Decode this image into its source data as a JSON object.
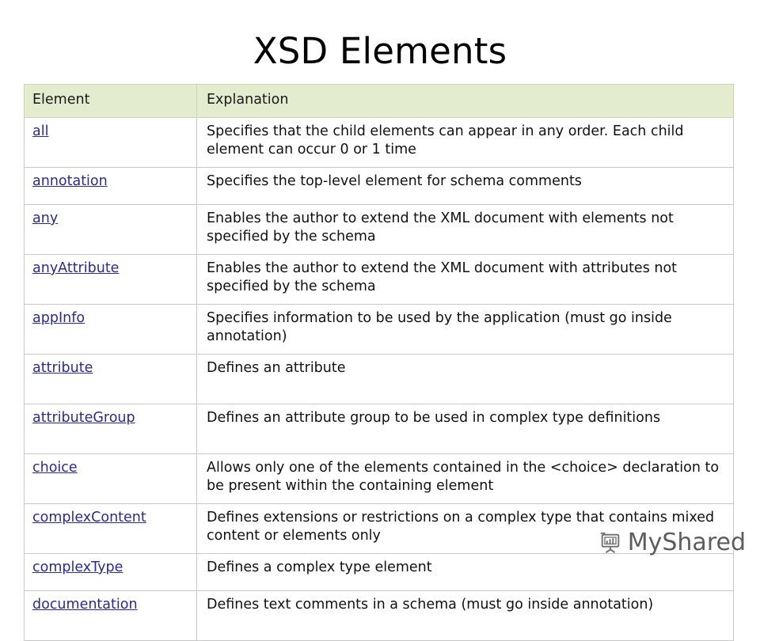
{
  "slide": {
    "title": "XSD Elements"
  },
  "table": {
    "columns": [
      "Element",
      "Explanation"
    ],
    "rows": [
      {
        "element": "all",
        "explanation": "Specifies that the child elements can appear in any order. Each child element can occur 0 or 1 time",
        "lines": 2
      },
      {
        "element": "annotation",
        "explanation": "Specifies the top-level element for schema comments",
        "lines": 1
      },
      {
        "element": "any",
        "explanation": "Enables the author to extend the XML document with elements not specified by the schema",
        "lines": 2
      },
      {
        "element": "anyAttribute",
        "explanation": "Enables the author to extend the XML document with attributes not specified by the schema",
        "lines": 2
      },
      {
        "element": "appInfo",
        "explanation": "Specifies information to be used by the application (must go inside annotation)",
        "lines": 2
      },
      {
        "element": "attribute",
        "explanation": "Defines an attribute",
        "lines": 2
      },
      {
        "element": "attributeGroup",
        "explanation": "Defines an attribute group to be used in complex type definitions",
        "lines": 2
      },
      {
        "element": "choice",
        "explanation": "Allows only one of the elements contained in the <choice> declaration to be present within the containing element",
        "lines": 2
      },
      {
        "element": "complexContent",
        "explanation": "Defines extensions or restrictions on a complex type that contains mixed content or elements only",
        "lines": 2
      },
      {
        "element": "complexType",
        "explanation": "Defines a complex type element",
        "lines": 1
      },
      {
        "element": "documentation",
        "explanation": "Defines text comments in a schema (must go inside annotation)",
        "lines": 2
      }
    ]
  },
  "watermark": {
    "text": "MyShared",
    "icon": "presentation-chart-icon"
  },
  "colors": {
    "header_background": "#e4ecd0",
    "link": "#2b2b8f",
    "border": "#c9c9c9",
    "text": "#111111",
    "watermark": "#5d5d5d"
  }
}
